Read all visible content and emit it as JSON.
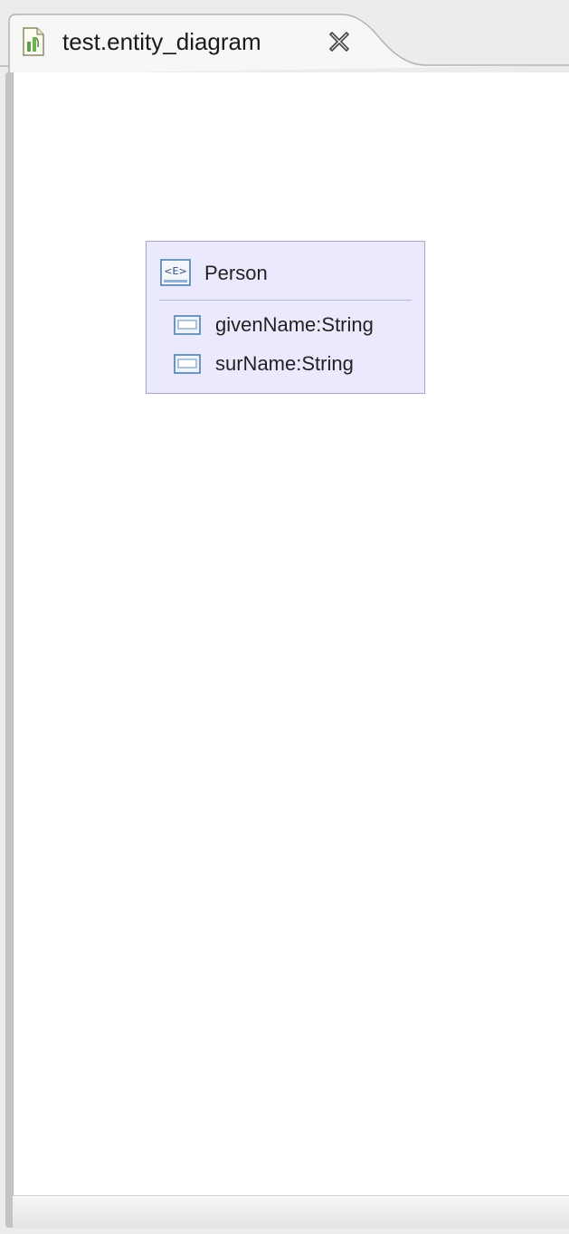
{
  "editor": {
    "tab": {
      "title": "test.entity_diagram",
      "icon": "diagram-file-icon",
      "close_icon": "close-icon"
    }
  },
  "diagram": {
    "entity": {
      "icon": "entity-icon",
      "icon_text": "<E>",
      "name": "Person",
      "attributes": [
        {
          "label": "givenName:String",
          "icon": "attribute-icon"
        },
        {
          "label": "surName:String",
          "icon": "attribute-icon"
        }
      ]
    }
  },
  "colors": {
    "canvas_background": "#ffffff",
    "entity_fill": "#eae9fd",
    "entity_border": "#a9a9c8",
    "tab_strip": "#ececec"
  }
}
